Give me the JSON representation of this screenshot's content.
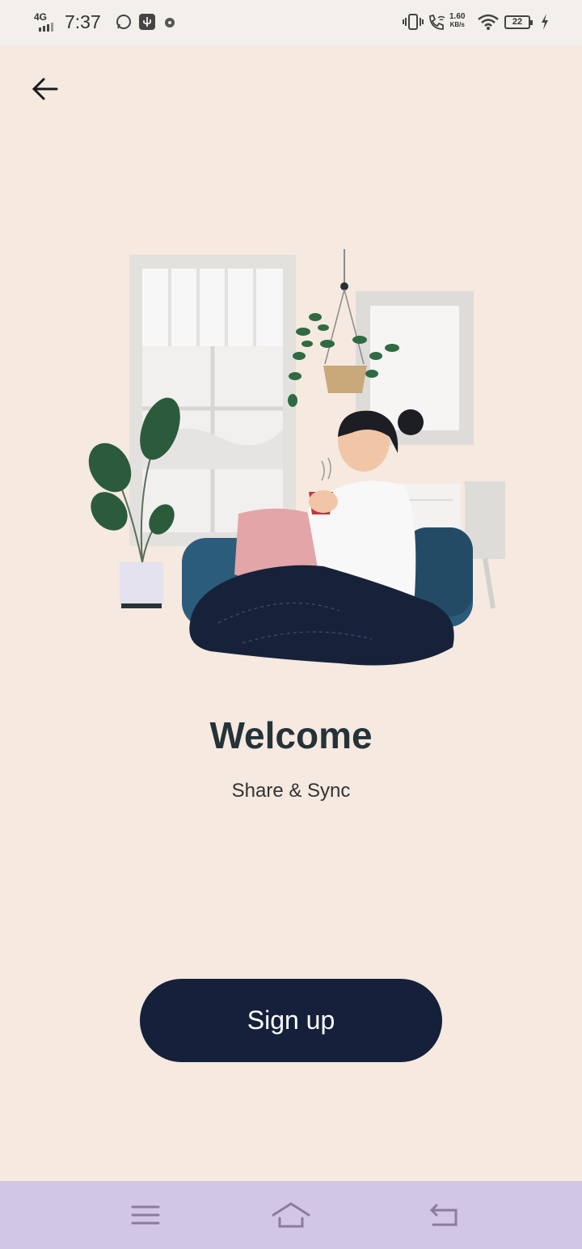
{
  "status_bar": {
    "network": "4G",
    "time": "7:37",
    "speed_value": "1.60",
    "speed_unit": "KB/s",
    "battery": "22"
  },
  "header": {
    "back_icon": "arrow-left-icon"
  },
  "main": {
    "title": "Welcome",
    "subtitle": "Share & Sync",
    "signup_label": "Sign up"
  },
  "nav_bar": {
    "items": [
      "menu-icon",
      "home-icon",
      "back-icon"
    ]
  },
  "colors": {
    "background": "#f5e9e0",
    "button": "#15203a",
    "nav": "#d2c6e6"
  }
}
